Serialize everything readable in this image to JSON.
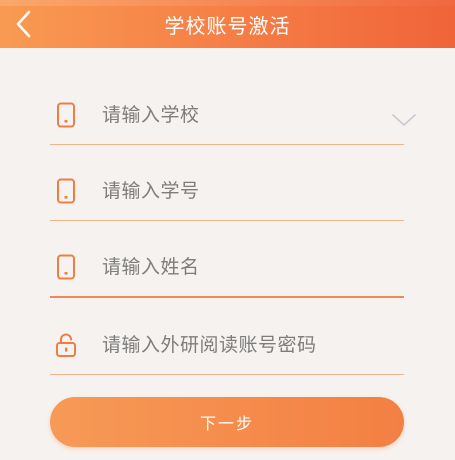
{
  "header": {
    "title": "学校账号激活",
    "back_icon": "chevron-left-icon"
  },
  "form": {
    "school": {
      "placeholder": "请输入学校",
      "icon": "phone-icon",
      "dropdown_icon": "chevron-down-icon"
    },
    "student_id": {
      "placeholder": "请输入学号",
      "icon": "phone-icon"
    },
    "name": {
      "placeholder": "请输入姓名",
      "icon": "phone-icon"
    },
    "password": {
      "placeholder": "请输入外研阅读账号密码",
      "icon": "unlock-icon"
    }
  },
  "actions": {
    "next_label": "下一步"
  },
  "colors": {
    "accent": "#f57c45",
    "icon": "#ef7e43",
    "divider": "#f1b48d",
    "background": "#f6f2ef",
    "placeholder": "#7d7d7d"
  }
}
